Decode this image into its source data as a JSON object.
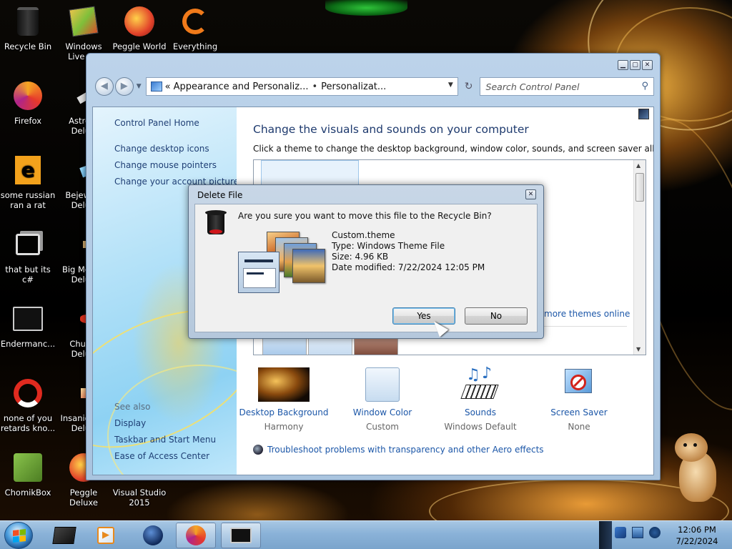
{
  "desktop": {
    "icons": [
      {
        "label": "Recycle Bin"
      },
      {
        "label": "Windows Live Ma"
      },
      {
        "label": "Peggle World"
      },
      {
        "label": "Everything"
      },
      {
        "label": "Firefox"
      },
      {
        "label": "Astro Delu"
      },
      {
        "label": "some russian ran a rat"
      },
      {
        "label": "Bejew Delu"
      },
      {
        "label": "that but its c#"
      },
      {
        "label": "Big Me Delu"
      },
      {
        "label": "Endermanc..."
      },
      {
        "label": "Chuz Delu"
      },
      {
        "label": "none of you retards kno..."
      },
      {
        "label": "Insaniq Delu"
      },
      {
        "label": "ChomikBox"
      },
      {
        "label": "Peggle Deluxe"
      },
      {
        "label": "Visual Studio 2015"
      }
    ]
  },
  "control_panel": {
    "breadcrumb": [
      "Appearance and Personaliz...",
      "Personalizat..."
    ],
    "breadcrumb_lead": "«",
    "breadcrumb_sep": "•",
    "search_placeholder": "Search Control Panel",
    "sidebar": {
      "links": [
        "Control Panel Home",
        "Change desktop icons",
        "Change mouse pointers",
        "Change your account picture"
      ],
      "see_also_label": "See also",
      "see_also": [
        "Display",
        "Taskbar and Start Menu",
        "Ease of Access Center"
      ]
    },
    "title": "Change the visuals and sounds on your computer",
    "subtitle": "Click a theme to change the desktop background, window color, sounds, and screen saver all at once.",
    "more_themes_link": "more themes online",
    "settings": [
      {
        "name": "Desktop Background",
        "value": "Harmony"
      },
      {
        "name": "Window Color",
        "value": "Custom"
      },
      {
        "name": "Sounds",
        "value": "Windows Default"
      },
      {
        "name": "Screen Saver",
        "value": "None"
      }
    ],
    "troubleshoot_link": "Troubleshoot problems with transparency and other Aero effects"
  },
  "dialog": {
    "title": "Delete File",
    "question": "Are you sure you want to move this file to the Recycle Bin?",
    "file_name": "Custom.theme",
    "file_type": "Type: Windows Theme File",
    "file_size": "Size: 4.96 KB",
    "file_modified": "Date modified: 7/22/2024 12:05 PM",
    "yes_label": "Yes",
    "no_label": "No"
  },
  "taskbar": {
    "time": "12:06 PM",
    "date": "7/22/2024"
  },
  "colors": {
    "link": "#1c57a8",
    "taskbar": "#8ab2d8"
  }
}
